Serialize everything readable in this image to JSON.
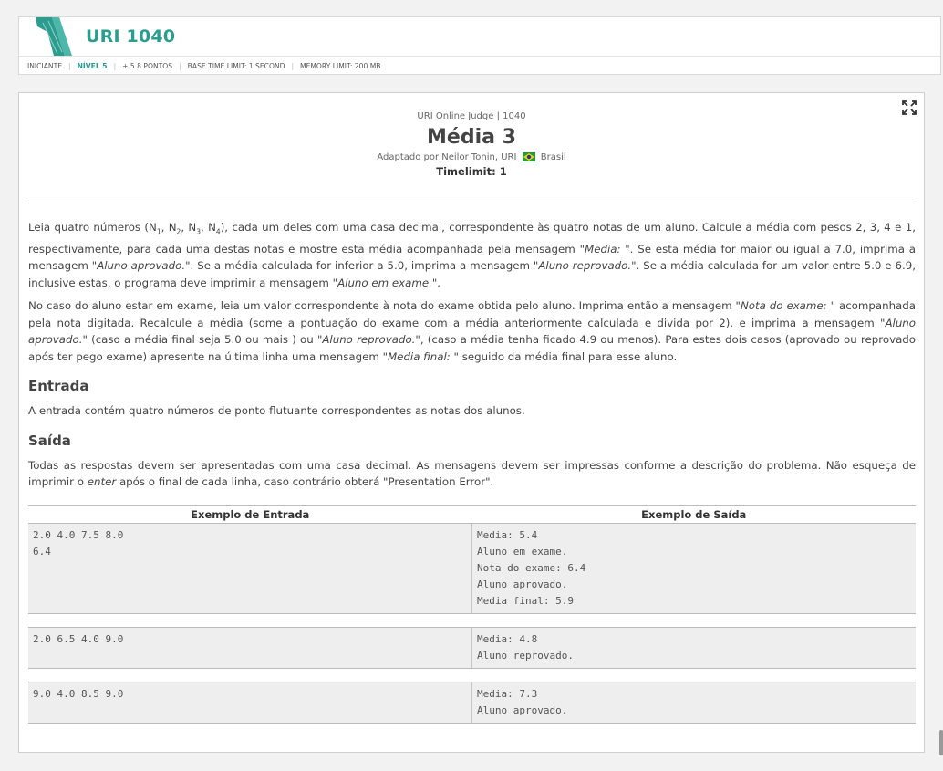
{
  "header": {
    "code_title": "URI 1040",
    "meta": {
      "category": "INICIANTE",
      "level": "NÍVEL 5",
      "points": "+ 5.8 PONTOS",
      "time_limit": "BASE TIME LIMIT: 1 SECOND",
      "memory_limit": "MEMORY LIMIT: 200 MB"
    }
  },
  "problem": {
    "judge_line": "URI Online Judge | 1040",
    "title": "Média 3",
    "author_prefix": "Adaptado por Neilor Tonin, URI",
    "author_country": "Brasil",
    "timelimit": "Timelimit: 1",
    "p1": {
      "a": "Leia quatro números (N",
      "s1": "1",
      "b": ", N",
      "s2": "2",
      "c": ", N",
      "s3": "3",
      "d": ", N",
      "s4": "4",
      "e": "), cada um deles com uma casa decimal, correspondente às quatro notas de um aluno. Calcule a média com pesos 2, 3, 4 e 1, respectivamente, para cada uma destas notas e mostre esta média acompanhada pela mensagem ",
      "i1": "\"Media: \"",
      "f": ". Se esta média for maior ou igual a 7.0, imprima a mensagem ",
      "i2": "\"Aluno aprovado.\"",
      "g": ". Se a média calculada for inferior a 5.0, imprima a mensagem ",
      "i3": "\"Aluno reprovado.\"",
      "h": ". Se a média calculada for um valor entre 5.0 e 6.9, inclusive estas, o programa deve imprimir a mensagem ",
      "i4": "\"Aluno em exame.\"",
      "j": "."
    },
    "p2": {
      "a": "No caso do aluno estar em exame, leia um valor correspondente à nota do exame obtida pelo aluno. Imprima então a mensagem ",
      "i1": "\"Nota do exame: \"",
      "b": " acompanhada pela nota digitada. Recalcule a média (some a pontuação do exame com a média anteriormente calculada e divida por 2). e imprima a mensagem ",
      "i2": "\"Aluno aprovado.\"",
      "c": " (caso a média final seja 5.0 ou mais ) ou ",
      "i3": "\"Aluno reprovado.\"",
      "d": ", (caso a média tenha ficado 4.9 ou menos). Para estes dois casos (aprovado ou reprovado após ter pego exame) apresente na última linha uma mensagem ",
      "i4": "\"Media final: \"",
      "e": " seguido da média final para esse aluno."
    },
    "input_title": "Entrada",
    "input_text": "A entrada contém quatro números de ponto flutuante correspondentes as notas dos alunos.",
    "output_title": "Saída",
    "output_text_a": "Todas as respostas devem ser apresentadas com uma casa decimal. As mensagens devem ser impressas conforme a descrição do problema. Não esqueça de imprimir o ",
    "output_text_i": "enter",
    "output_text_b": " após o final de cada linha, caso contrário obterá \"Presentation Error\".",
    "examples_header_in": "Exemplo de Entrada",
    "examples_header_out": "Exemplo de Saída",
    "examples": [
      {
        "input": "2.0 4.0 7.5 8.0\n6.4",
        "output": "Media: 5.4\nAluno em exame.\nNota do exame: 6.4\nAluno aprovado.\nMedia final: 5.9"
      },
      {
        "input": "2.0 6.5 4.0 9.0",
        "output": "Media: 4.8\nAluno reprovado."
      },
      {
        "input": "9.0 4.0 8.5 9.0",
        "output": "Media: 7.3\nAluno aprovado."
      }
    ]
  },
  "colors": {
    "accent": "#2a9d8f",
    "flag_green": "#1f9d3a",
    "flag_yellow": "#f7d000"
  }
}
